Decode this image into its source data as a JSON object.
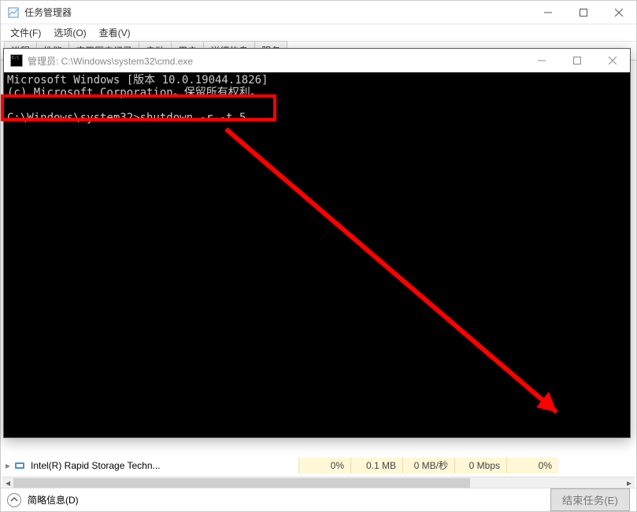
{
  "task_manager": {
    "title": "任务管理器",
    "menu": {
      "file": "文件(F)",
      "options": "选项(O)",
      "view": "查看(V)"
    },
    "tabs": [
      "进程",
      "性能",
      "应用历史记录",
      "启动",
      "用户",
      "详细信息",
      "服务"
    ],
    "process_row": {
      "name": "Intel(R) Rapid Storage Techn...",
      "cpu": "0%",
      "memory": "0.1 MB",
      "disk": "0 MB/秒",
      "network": "0 Mbps",
      "gpu": "0%"
    },
    "footer": {
      "brief_info": "简略信息(D)",
      "end_task": "结束任务(E)"
    }
  },
  "cmd": {
    "title": "管理员: C:\\Windows\\system32\\cmd.exe",
    "line1": "Microsoft Windows [版本 10.0.19044.1826]",
    "line2": "(c) Microsoft Corporation。保留所有权利。",
    "prompt_line": "C:\\Windows\\system32>shutdown -r -t 5"
  }
}
